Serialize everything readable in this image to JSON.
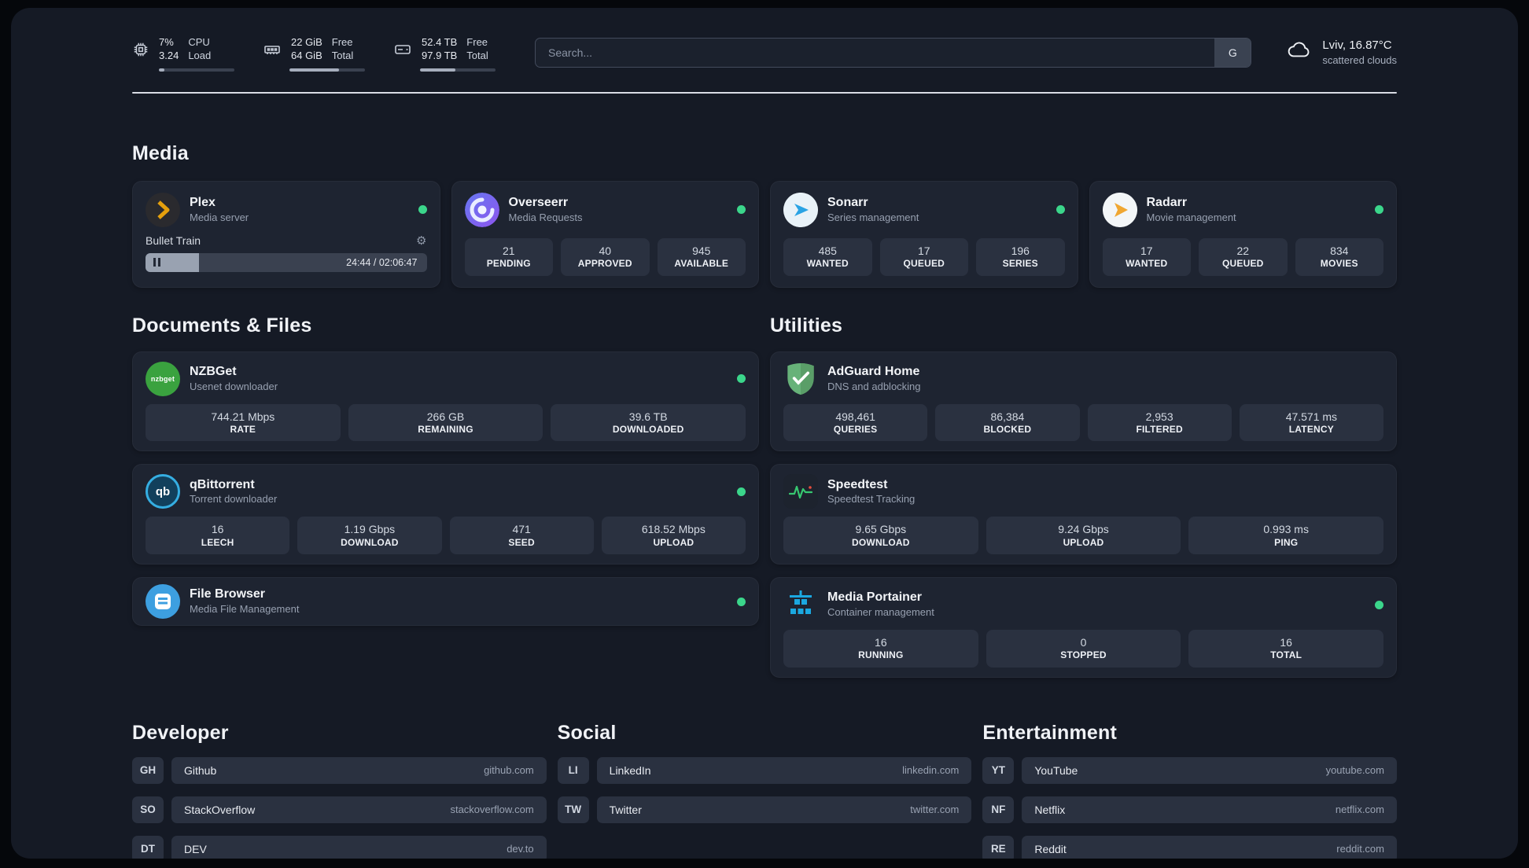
{
  "colors": {
    "status_online": "#3bd68b",
    "panel_bg": "#151a25",
    "card_bg": "#1e2431",
    "tile_bg": "#2a3140",
    "plex_accent": "#e5a00d",
    "sonarr_accent": "#2aa3e4",
    "radarr_accent": "#f0a732",
    "adguard_accent": "#67b279",
    "portainer_accent": "#1ba8e0"
  },
  "header": {
    "cpu": {
      "icon": "cpu-icon",
      "top": "7%",
      "bottom": "3.24",
      "label_top": "CPU",
      "label_bottom": "Load",
      "progress": 7
    },
    "memory": {
      "icon": "memory-icon",
      "top": "22 GiB",
      "bottom": "64 GiB",
      "label_top": "Free",
      "label_bottom": "Total",
      "progress": 66
    },
    "disk": {
      "icon": "disk-icon",
      "top": "52.4 TB",
      "bottom": "97.9 TB",
      "label_top": "Free",
      "label_bottom": "Total",
      "progress": 47
    },
    "search": {
      "placeholder": "Search...",
      "button_label": "G"
    },
    "weather": {
      "icon": "cloud-icon",
      "location": "Lviv, 16.87°C",
      "condition": "scattered clouds"
    }
  },
  "sections": {
    "media": {
      "title": "Media",
      "apps": [
        {
          "name": "Plex",
          "subtitle": "Media server",
          "icon": "plex-icon",
          "status": "online",
          "player": {
            "track": "Bullet Train",
            "time": "24:44 / 02:06:47",
            "progress": 19
          }
        },
        {
          "name": "Overseerr",
          "subtitle": "Media Requests",
          "icon": "overseerr-icon",
          "status": "online",
          "stats": [
            {
              "value": "21",
              "label": "PENDING"
            },
            {
              "value": "40",
              "label": "APPROVED"
            },
            {
              "value": "945",
              "label": "AVAILABLE"
            }
          ]
        },
        {
          "name": "Sonarr",
          "subtitle": "Series management",
          "icon": "sonarr-icon",
          "status": "online",
          "stats": [
            {
              "value": "485",
              "label": "WANTED"
            },
            {
              "value": "17",
              "label": "QUEUED"
            },
            {
              "value": "196",
              "label": "SERIES"
            }
          ]
        },
        {
          "name": "Radarr",
          "subtitle": "Movie management",
          "icon": "radarr-icon",
          "status": "online",
          "stats": [
            {
              "value": "17",
              "label": "WANTED"
            },
            {
              "value": "22",
              "label": "QUEUED"
            },
            {
              "value": "834",
              "label": "MOVIES"
            }
          ]
        }
      ]
    },
    "documents": {
      "title": "Documents & Files",
      "apps": [
        {
          "name": "NZBGet",
          "subtitle": "Usenet downloader",
          "icon": "nzbget-icon",
          "icon_text": "nzbget",
          "status": "online",
          "stats": [
            {
              "value": "744.21 Mbps",
              "label": "RATE"
            },
            {
              "value": "266 GB",
              "label": "REMAINING"
            },
            {
              "value": "39.6 TB",
              "label": "DOWNLOADED"
            }
          ]
        },
        {
          "name": "qBittorrent",
          "subtitle": "Torrent downloader",
          "icon": "qbittorrent-icon",
          "icon_text": "qb",
          "status": "online",
          "stats": [
            {
              "value": "16",
              "label": "LEECH"
            },
            {
              "value": "1.19 Gbps",
              "label": "DOWNLOAD"
            },
            {
              "value": "471",
              "label": "SEED"
            },
            {
              "value": "618.52 Mbps",
              "label": "UPLOAD"
            }
          ]
        },
        {
          "name": "File Browser",
          "subtitle": "Media File Management",
          "icon": "filebrowser-icon",
          "status": "online",
          "stats": []
        }
      ]
    },
    "utilities": {
      "title": "Utilities",
      "apps": [
        {
          "name": "AdGuard Home",
          "subtitle": "DNS and adblocking",
          "icon": "adguard-icon",
          "stats": [
            {
              "value": "498,461",
              "label": "QUERIES"
            },
            {
              "value": "86,384",
              "label": "BLOCKED"
            },
            {
              "value": "2,953",
              "label": "FILTERED"
            },
            {
              "value": "47.571 ms",
              "label": "LATENCY"
            }
          ]
        },
        {
          "name": "Speedtest",
          "subtitle": "Speedtest Tracking",
          "icon": "speedtest-icon",
          "stats": [
            {
              "value": "9.65 Gbps",
              "label": "DOWNLOAD"
            },
            {
              "value": "9.24 Gbps",
              "label": "UPLOAD"
            },
            {
              "value": "0.993 ms",
              "label": "PING"
            }
          ]
        },
        {
          "name": "Media Portainer",
          "subtitle": "Container management",
          "icon": "portainer-icon",
          "status": "online",
          "stats": [
            {
              "value": "16",
              "label": "RUNNING"
            },
            {
              "value": "0",
              "label": "STOPPED"
            },
            {
              "value": "16",
              "label": "TOTAL"
            }
          ]
        }
      ]
    },
    "links": [
      {
        "title": "Developer",
        "items": [
          {
            "abbr": "GH",
            "name": "Github",
            "url": "github.com"
          },
          {
            "abbr": "SO",
            "name": "StackOverflow",
            "url": "stackoverflow.com"
          },
          {
            "abbr": "DT",
            "name": "DEV",
            "url": "dev.to"
          }
        ]
      },
      {
        "title": "Social",
        "items": [
          {
            "abbr": "LI",
            "name": "LinkedIn",
            "url": "linkedin.com"
          },
          {
            "abbr": "TW",
            "name": "Twitter",
            "url": "twitter.com"
          }
        ]
      },
      {
        "title": "Entertainment",
        "items": [
          {
            "abbr": "YT",
            "name": "YouTube",
            "url": "youtube.com"
          },
          {
            "abbr": "NF",
            "name": "Netflix",
            "url": "netflix.com"
          },
          {
            "abbr": "RE",
            "name": "Reddit",
            "url": "reddit.com"
          }
        ]
      }
    ]
  }
}
